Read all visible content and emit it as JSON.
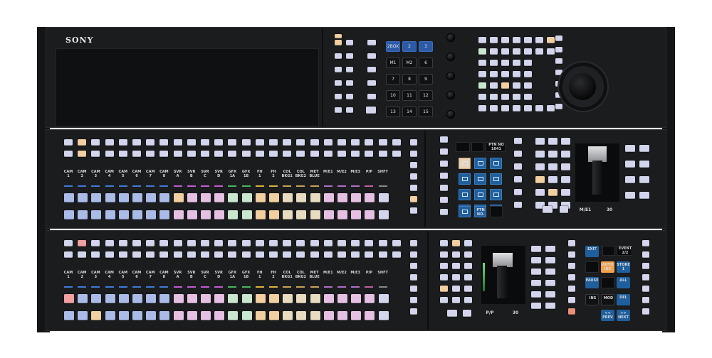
{
  "brand": "SONY",
  "colors": {
    "panel": "#1b1c1e",
    "key_lavender": "#d3d5ec",
    "key_peach": "#f1cfa1",
    "key_green": "#c9e6cf",
    "key_blue_row": "#aabbe8",
    "key_pink": "#e6c0e3",
    "key_red": "#f0a0a0",
    "key_teal": "#a6e2d8",
    "accent_blue": "#2c5aa6"
  },
  "top_numpad": {
    "keys": [
      "2BOX",
      "2",
      "3",
      "M1",
      "M2",
      "6",
      "7",
      "8",
      "9",
      "10",
      "11",
      "12",
      "13",
      "14",
      "15"
    ]
  },
  "bus_labels": [
    "CAM\n1",
    "CAM\n2",
    "CAM\n3",
    "CAM\n4",
    "CAM\n5",
    "CAM\n6",
    "CAM\n7",
    "CAM\n8",
    "SVR\nA",
    "SVR\nB",
    "SVR\nC",
    "SVR\nD",
    "GFX\n1A",
    "GFX\n1B",
    "FH\n1",
    "FH\n2",
    "COL\nBKG1",
    "COL\nBKG2",
    "MET\nBLUE",
    "M/E1",
    "M/E2",
    "M/E3",
    "P/P",
    "SHFT"
  ],
  "upper_right": {
    "pattern_display_line1": "PTN NO",
    "pattern_display_line2": "1041",
    "ptn_no_key": "PTN\nNO.",
    "me_display": "M/E1",
    "me_value": "30"
  },
  "lower_right": {
    "pp_display": "P/P",
    "pp_value": "30",
    "event_label": "EVENT",
    "event_value": "2/2",
    "keys": {
      "exit": "EXIT",
      "auto_ins": "AUTO\nINS",
      "store": "STORE\n1",
      "pause": "PAUSE",
      "all": "ALL",
      "ins": "INS",
      "mod": "MOD",
      "del": "DEL",
      "prev": "<<\nPREV",
      "next": ">>\nNEXT"
    }
  }
}
